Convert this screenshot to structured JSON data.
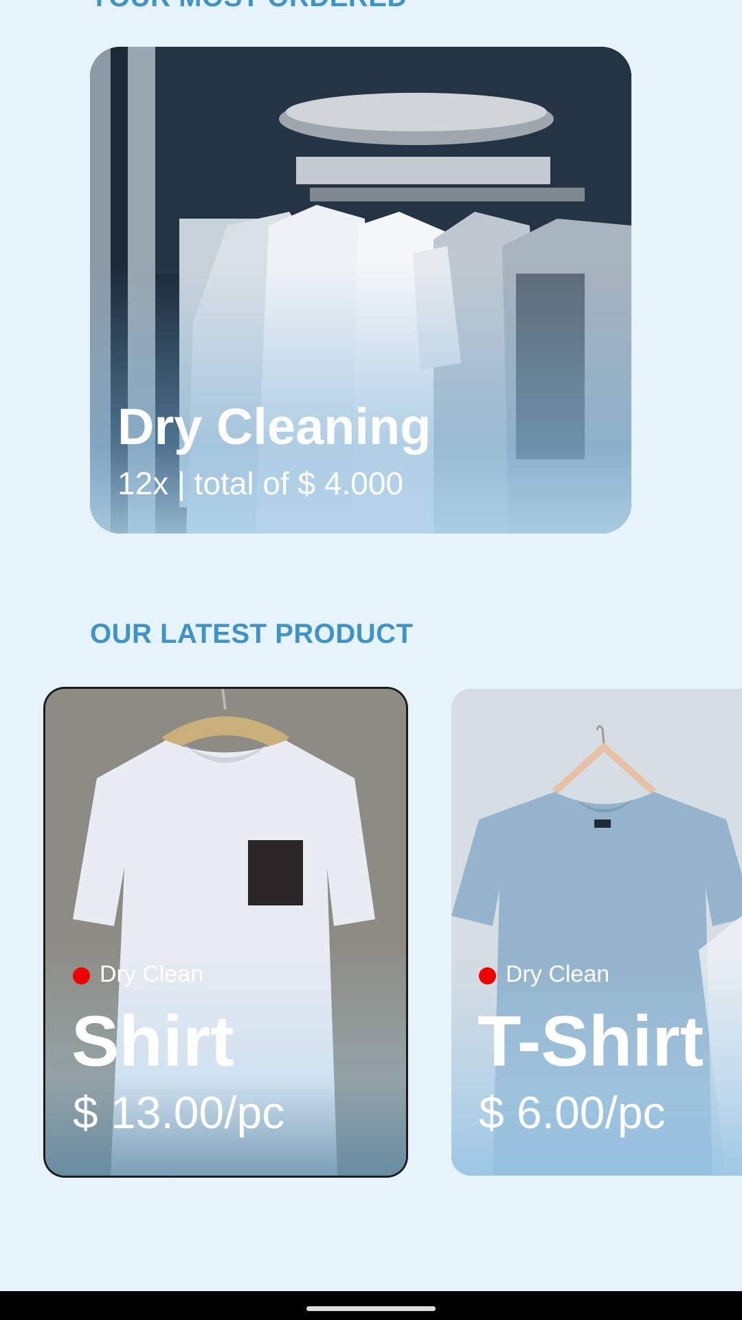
{
  "most_ordered": {
    "section_title": "YOUR MOST ORDERED",
    "item": {
      "name": "Dry Cleaning",
      "summary": "12x | total of $ 4.000",
      "image": "dry-cleaning-rack-photo"
    }
  },
  "latest": {
    "section_title": "OUR LATEST PRODUCT",
    "products": [
      {
        "tag": "Dry Clean",
        "name": "Shirt",
        "price": "$ 13.00/pc",
        "image": "white-shirt-photo"
      },
      {
        "tag": "Dry Clean",
        "name": "T-Shirt",
        "price": "$ 6.00/pc",
        "image": "blue-tshirt-photo"
      }
    ]
  },
  "colors": {
    "background": "#e6f3fb",
    "section_title": "#3f93c6",
    "tag_dot": "#f10000",
    "text_on_image": "#ffffff"
  }
}
